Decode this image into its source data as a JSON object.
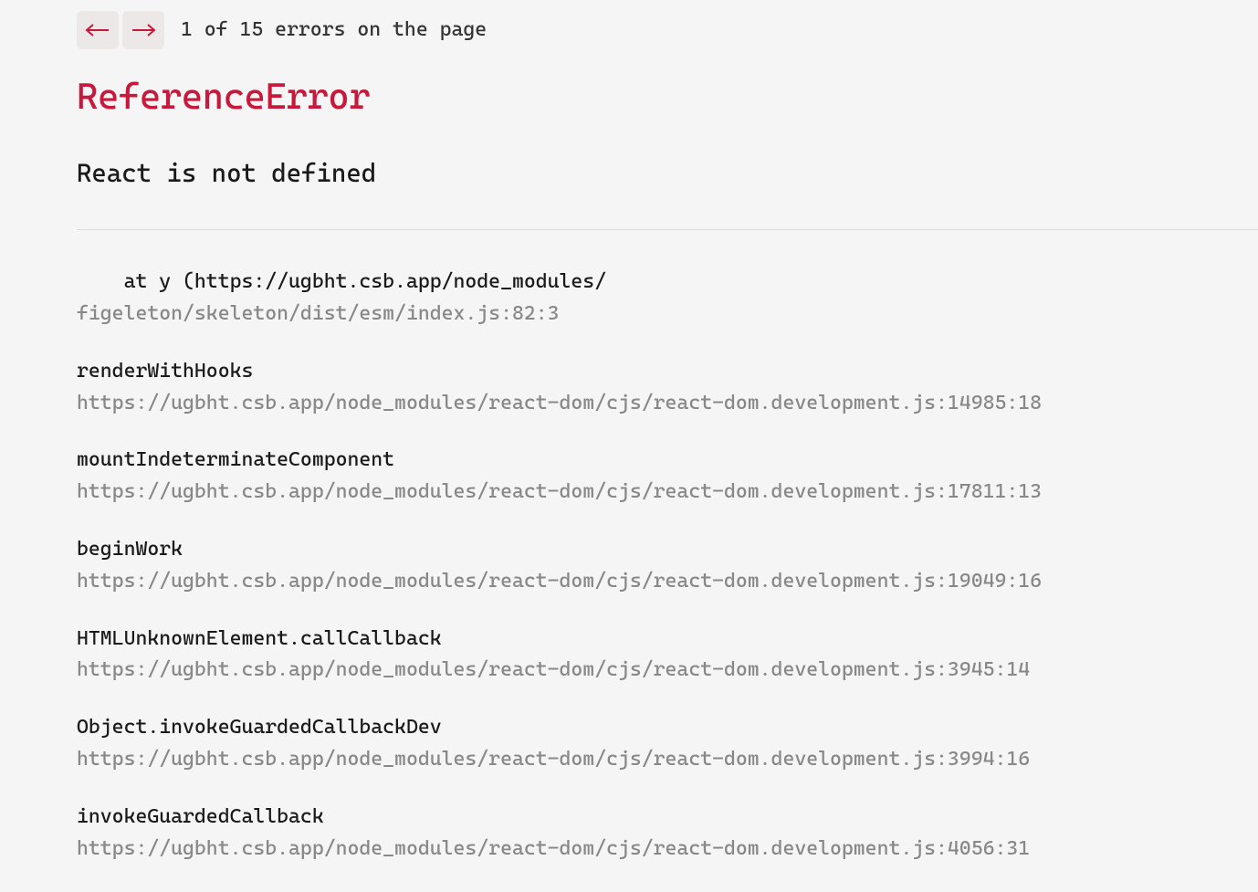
{
  "nav": {
    "prev_label": "←",
    "next_label": "→",
    "counter": "1 of 15 errors on the page"
  },
  "error": {
    "type": "ReferenceError",
    "message": "React is not defined"
  },
  "stack_raw": {
    "line": "    at y (https://ugbht.csb.app/node_modules/",
    "location": "figeleton/skeleton/dist/esm/index.js:82:3"
  },
  "frames": [
    {
      "fn": "renderWithHooks",
      "loc": "https://ugbht.csb.app/node_modules/react-dom/cjs/react-dom.development.js:14985:18"
    },
    {
      "fn": "mountIndeterminateComponent",
      "loc": "https://ugbht.csb.app/node_modules/react-dom/cjs/react-dom.development.js:17811:13"
    },
    {
      "fn": "beginWork",
      "loc": "https://ugbht.csb.app/node_modules/react-dom/cjs/react-dom.development.js:19049:16"
    },
    {
      "fn": "HTMLUnknownElement.callCallback",
      "loc": "https://ugbht.csb.app/node_modules/react-dom/cjs/react-dom.development.js:3945:14"
    },
    {
      "fn": "Object.invokeGuardedCallbackDev",
      "loc": "https://ugbht.csb.app/node_modules/react-dom/cjs/react-dom.development.js:3994:16"
    },
    {
      "fn": "invokeGuardedCallback",
      "loc": "https://ugbht.csb.app/node_modules/react-dom/cjs/react-dom.development.js:4056:31"
    }
  ]
}
